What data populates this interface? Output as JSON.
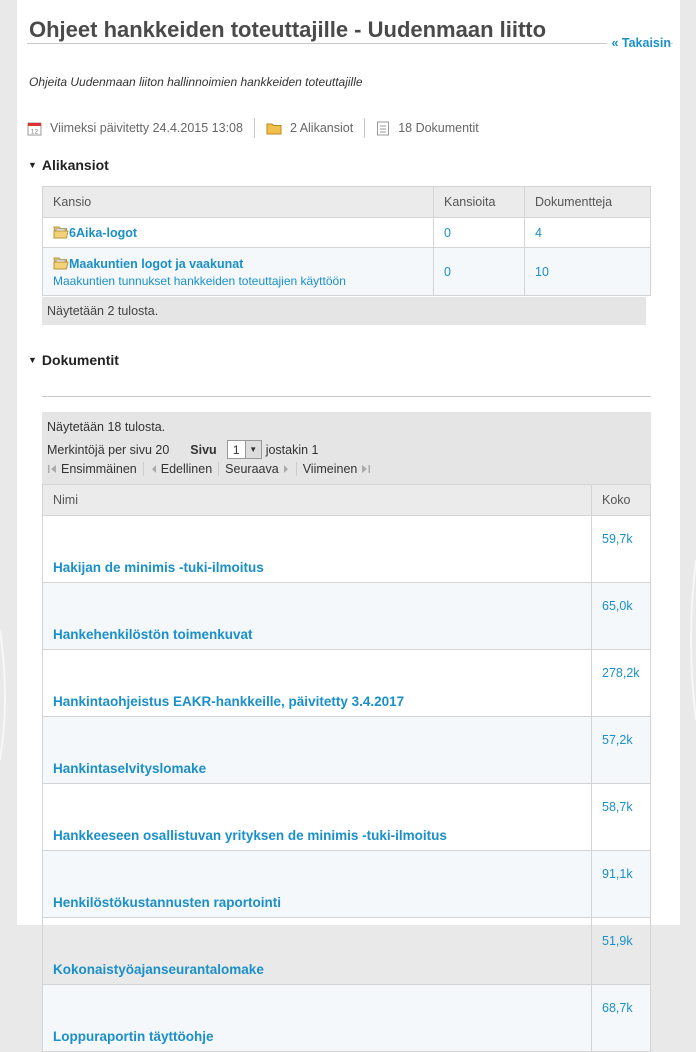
{
  "page": {
    "title": "Ohjeet hankkeiden toteuttajille - Uudenmaan liitto",
    "back_link": "« Takaisin",
    "description": "Ohjeita Uudenmaan liiton hallinnoimien hankkeiden toteuttajille"
  },
  "meta": {
    "updated": "Viimeksi päivitetty 24.4.2015 13:08",
    "subfolders": "2 Alikansiot",
    "documents": "18 Dokumentit"
  },
  "folders_section": {
    "heading": "Alikansiot",
    "columns": [
      "Kansio",
      "Kansioita",
      "Dokumentteja"
    ],
    "rows": [
      {
        "name": "6Aika-logot",
        "description": "",
        "folders": "0",
        "docs": "4"
      },
      {
        "name": "Maakuntien logot ja vaakunat",
        "description": "Maakuntien tunnukset hankkeiden toteuttajien käyttöön",
        "folders": "0",
        "docs": "10"
      }
    ],
    "footer": "Näytetään 2 tulosta."
  },
  "documents_section": {
    "heading": "Dokumentit",
    "pager": {
      "showing": "Näytetään 18 tulosta.",
      "per_page": "Merkintöjä per sivu 20",
      "page_label": "Sivu",
      "page_value": "1",
      "of_pages": "jostakin 1",
      "first": "Ensimmäinen",
      "prev": "Edellinen",
      "next": "Seuraava",
      "last": "Viimeinen"
    },
    "columns": [
      "Nimi",
      "Koko"
    ],
    "rows": [
      {
        "name": "Hakijan de minimis -tuki-ilmoitus",
        "size": "59,7k"
      },
      {
        "name": "Hankehenkilöstön toimenkuvat",
        "size": "65,0k"
      },
      {
        "name": "Hankintaohjeistus EAKR-hankkeille, päivitetty 3.4.2017",
        "size": "278,2k"
      },
      {
        "name": "Hankintaselvityslomake",
        "size": "57,2k"
      },
      {
        "name": "Hankkeeseen osallistuvan yrityksen de minimis -tuki-ilmoitus",
        "size": "58,7k"
      },
      {
        "name": "Henkilöstökustannusten raportointi",
        "size": "91,1k"
      },
      {
        "name": "Kokonaistyöajanseurantalomake",
        "size": "51,9k"
      },
      {
        "name": "Loppuraportin täyttöohje",
        "size": "68,7k"
      }
    ]
  },
  "colors": {
    "link": "#1a8fc9",
    "page_bg": "#e9e9e9"
  }
}
